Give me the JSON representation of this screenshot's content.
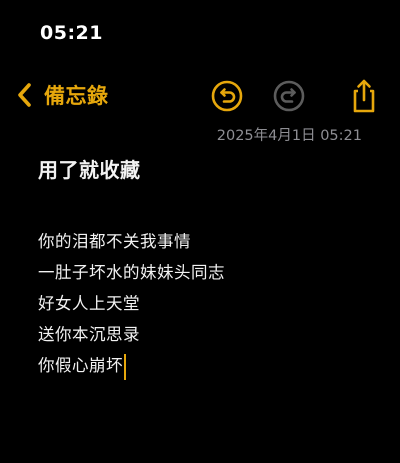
{
  "status_bar": {
    "time": "05:21"
  },
  "nav": {
    "back_label": "備忘錄"
  },
  "icons": {
    "back": "chevron-left-icon",
    "undo": "undo-icon",
    "redo": "redo-icon",
    "share": "share-icon"
  },
  "colors": {
    "background": "#000000",
    "accent": "#e6a70c",
    "disabled_icon": "#5c5c5c",
    "timestamp": "#8e8e93",
    "text": "#f2f2f2"
  },
  "note": {
    "timestamp": "2025年4月1日 05:21",
    "title": "用了就收藏",
    "lines": [
      "你的泪都不关我事情",
      "一肚子坏水的妹妹头同志",
      "好女人上天堂",
      "送你本沉思录",
      "你假心崩坏"
    ]
  }
}
